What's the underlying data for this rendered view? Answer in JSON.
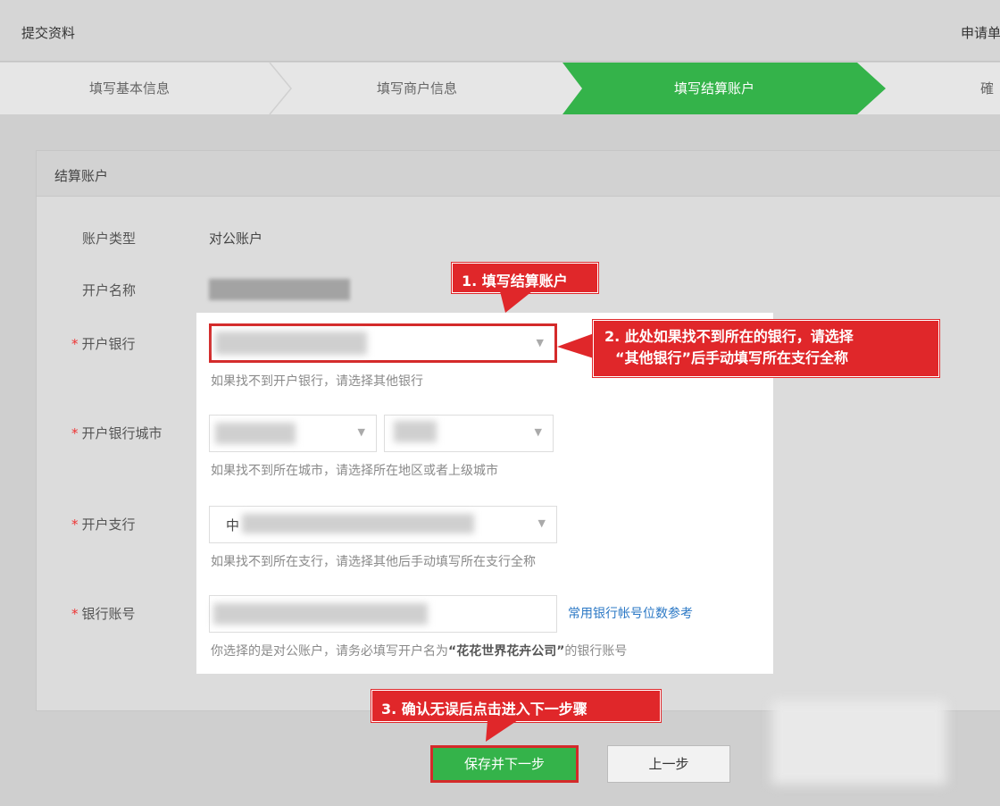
{
  "header": {
    "title": "提交资料",
    "apply": "申请单"
  },
  "steps": [
    {
      "label": "填写基本信息"
    },
    {
      "label": "填写商户信息"
    },
    {
      "label": "填写结算账户",
      "active": true,
      "color": "#34b34a"
    },
    {
      "label": "確"
    }
  ],
  "panel": {
    "title": "结算账户"
  },
  "form": {
    "account_type_label": "账户类型",
    "account_type_value": "对公账户",
    "account_name_label": "开户名称",
    "bank_label": "开户银行",
    "bank_hint": "如果找不到开户银行，请选择其他银行",
    "city_label": "开户银行城市",
    "city_hint": "如果找不到所在城市，请选择所在地区或者上级城市",
    "branch_label": "开户支行",
    "branch_value": "中",
    "branch_hint": "如果找不到所在支行，请选择其他后手动填写所在支行全称",
    "account_number_label": "银行账号",
    "account_number_link": "常用银行帐号位数参考",
    "account_hint_prefix": "你选择的是对公账户，请务必填写开户名为",
    "account_hint_company": "“花花世界花卉公司”",
    "account_hint_suffix": "的银行账号",
    "required_mark": "*"
  },
  "callouts": {
    "c1": "1. 填写结算账户",
    "c2_line1": "2. 此处如果找不到所在的银行，请选择",
    "c2_line2": "“其他银行”后手动填写所在支行全称",
    "c3": "3. 确认无误后点击进入下一步骤",
    "color": "#e0272a"
  },
  "buttons": {
    "save_next": "保存并下一步",
    "previous": "上一步"
  },
  "icons": {
    "dropdown": "chevron-down-icon"
  }
}
